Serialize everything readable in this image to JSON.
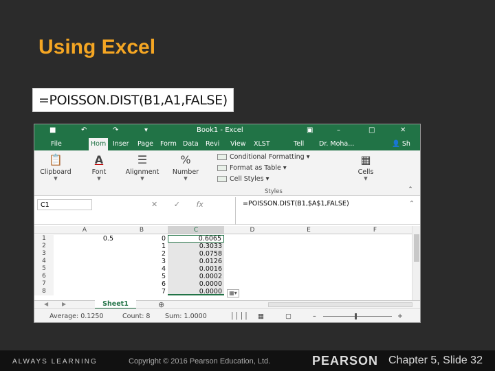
{
  "slide": {
    "title": "Using Excel",
    "formula_callout": "=POISSON.DIST(B1,A1,FALSE)"
  },
  "excel": {
    "window_title": "Book1 - Excel",
    "tabs": [
      "File",
      "Hom",
      "Inser",
      "Page",
      "Form",
      "Data",
      "Revi",
      "View",
      "XLST",
      "Tell",
      "Dr. Moha...",
      "Sh"
    ],
    "active_tab_index": 1,
    "ribbon": {
      "clipboard": "Clipboard",
      "font": "Font",
      "alignment": "Alignment",
      "number": "Number",
      "conditional_formatting": "Conditional Formatting",
      "format_as_table": "Format as Table",
      "cell_styles": "Cell Styles",
      "styles_group": "Styles",
      "cells": "Cells"
    },
    "name_box": "C1",
    "formula_bar": "=POISSON.DIST(B1,$A$1,FALSE)",
    "fx_label": "fx",
    "columns": [
      "A",
      "B",
      "C",
      "D",
      "E",
      "F"
    ],
    "selected_column": "C",
    "rows": [
      {
        "row": "1",
        "A": "0.5",
        "B": "0",
        "C": "0.6065"
      },
      {
        "row": "2",
        "A": "",
        "B": "1",
        "C": "0.3033"
      },
      {
        "row": "3",
        "A": "",
        "B": "2",
        "C": "0.0758"
      },
      {
        "row": "4",
        "A": "",
        "B": "3",
        "C": "0.0126"
      },
      {
        "row": "5",
        "A": "",
        "B": "4",
        "C": "0.0016"
      },
      {
        "row": "6",
        "A": "",
        "B": "5",
        "C": "0.0002"
      },
      {
        "row": "7",
        "A": "",
        "B": "6",
        "C": "0.0000"
      },
      {
        "row": "8",
        "A": "",
        "B": "7",
        "C": "0.0000"
      }
    ],
    "sheet_tab": "Sheet1",
    "status": {
      "average": "Average: 0.1250",
      "count": "Count: 8",
      "sum": "Sum: 1.0000"
    }
  },
  "footer": {
    "left": "ALWAYS LEARNING",
    "copyright": "Copyright © 2016 Pearson Education, Ltd.",
    "brand": "PEARSON",
    "slide_ref": "Chapter 5, Slide 32"
  },
  "colors": {
    "title": "#f5a623",
    "excel_green": "#217346",
    "background": "#2b2b2b"
  }
}
